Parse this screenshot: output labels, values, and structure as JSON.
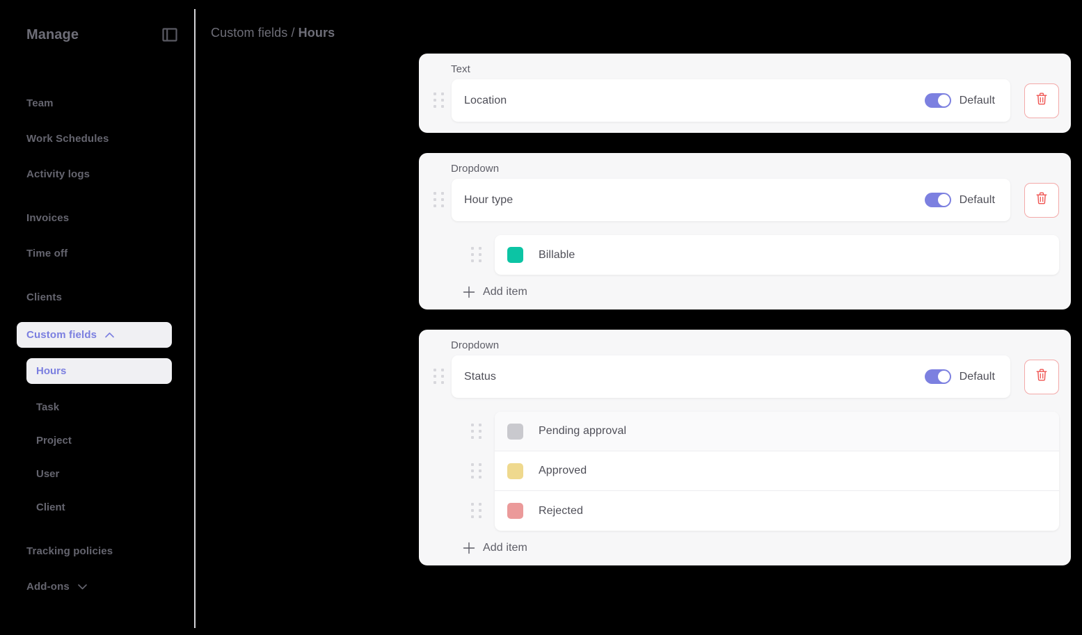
{
  "sidebar": {
    "title": "Manage",
    "panel_toggle_icon": "panel-toggle-icon",
    "items": [
      {
        "label": "Team",
        "gap": "lg"
      },
      {
        "label": "Work Schedules",
        "gap": "md"
      },
      {
        "label": "Activity logs",
        "gap": "md"
      },
      {
        "label": "Invoices",
        "gap": "lg"
      },
      {
        "label": "Time off",
        "gap": "md"
      },
      {
        "label": "Clients",
        "gap": "lg"
      }
    ],
    "group": {
      "label": "Custom fields",
      "expanded": true,
      "chevron_icon": "chevron-up-icon",
      "children": [
        {
          "label": "Hours",
          "active": true
        },
        {
          "label": "Task",
          "active": false
        },
        {
          "label": "Project",
          "active": false
        },
        {
          "label": "User",
          "active": false
        },
        {
          "label": "Client",
          "active": false
        }
      ]
    },
    "tracking_policies": "Tracking policies",
    "addons": {
      "label": "Add-ons",
      "chevron_icon": "chevron-down-icon"
    },
    "active_color": "#7b7fe0",
    "text_color": "#65656f"
  },
  "header": {
    "breadcrumb_parent": "Custom fields",
    "breadcrumb_separator": "/",
    "breadcrumb_current": "Hours"
  },
  "main": {
    "toggle_label": "Default",
    "add_item_label": "Add item",
    "delete_icon": "trash-icon",
    "drag_icon": "drag-handle-icon",
    "plus_icon": "plus-icon",
    "toggle_on_color": "#7c80e0",
    "delete_color": "#ef5350",
    "cards": [
      {
        "type": "Text",
        "name": "Location",
        "toggle_on": true,
        "options": []
      },
      {
        "type": "Dropdown",
        "name": "Hour type",
        "toggle_on": true,
        "options": [
          {
            "label": "Billable",
            "color": "#0cc4a4",
            "highlight": false
          }
        ]
      },
      {
        "type": "Dropdown",
        "name": "Status",
        "toggle_on": true,
        "options": [
          {
            "label": "Pending approval",
            "color": "#c9c9ce",
            "highlight": true
          },
          {
            "label": "Approved",
            "color": "#efd98e",
            "highlight": false
          },
          {
            "label": "Rejected",
            "color": "#eb9a9a",
            "highlight": false
          }
        ]
      }
    ]
  }
}
